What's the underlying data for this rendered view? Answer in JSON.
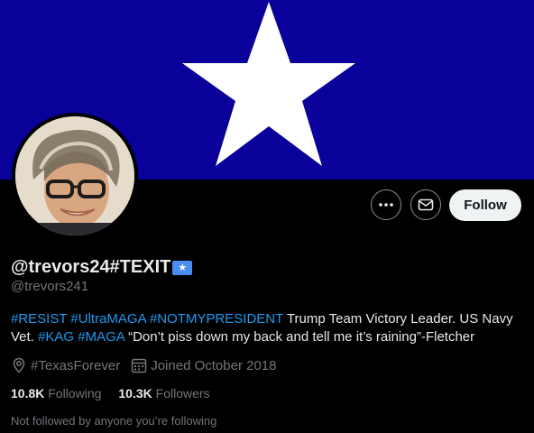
{
  "profile": {
    "display_name": "@trevors24#TEXIT",
    "flag_emoji": "★",
    "handle": "@trevors241",
    "bio_parts": [
      {
        "text": "#RESIST",
        "type": "hashtag"
      },
      {
        "text": " ",
        "type": "text"
      },
      {
        "text": "#UltraMAGA",
        "type": "hashtag"
      },
      {
        "text": " ",
        "type": "text"
      },
      {
        "text": "#NOTMYPRESIDENT",
        "type": "hashtag"
      },
      {
        "text": " Trump Team Victory Leader. US Navy Vet. ",
        "type": "text"
      },
      {
        "text": "#KAG",
        "type": "hashtag"
      },
      {
        "text": " ",
        "type": "text"
      },
      {
        "text": "#MAGA",
        "type": "hashtag"
      },
      {
        "text": " “Don’t piss down my back and tell me it’s raining”-Fletcher",
        "type": "text"
      }
    ],
    "location": "#TexasForever",
    "joined": "Joined October 2018",
    "following_count": "10.8K",
    "following_label": "Following",
    "followers_count": "10.3K",
    "followers_label": "Followers",
    "followed_by_note": "Not followed by anyone you’re following"
  },
  "actions": {
    "follow_label": "Follow",
    "more_icon": "more-icon",
    "message_icon": "envelope-icon"
  },
  "colors": {
    "banner": "#0a009a",
    "link": "#1d9bf0",
    "muted": "#71767b"
  }
}
